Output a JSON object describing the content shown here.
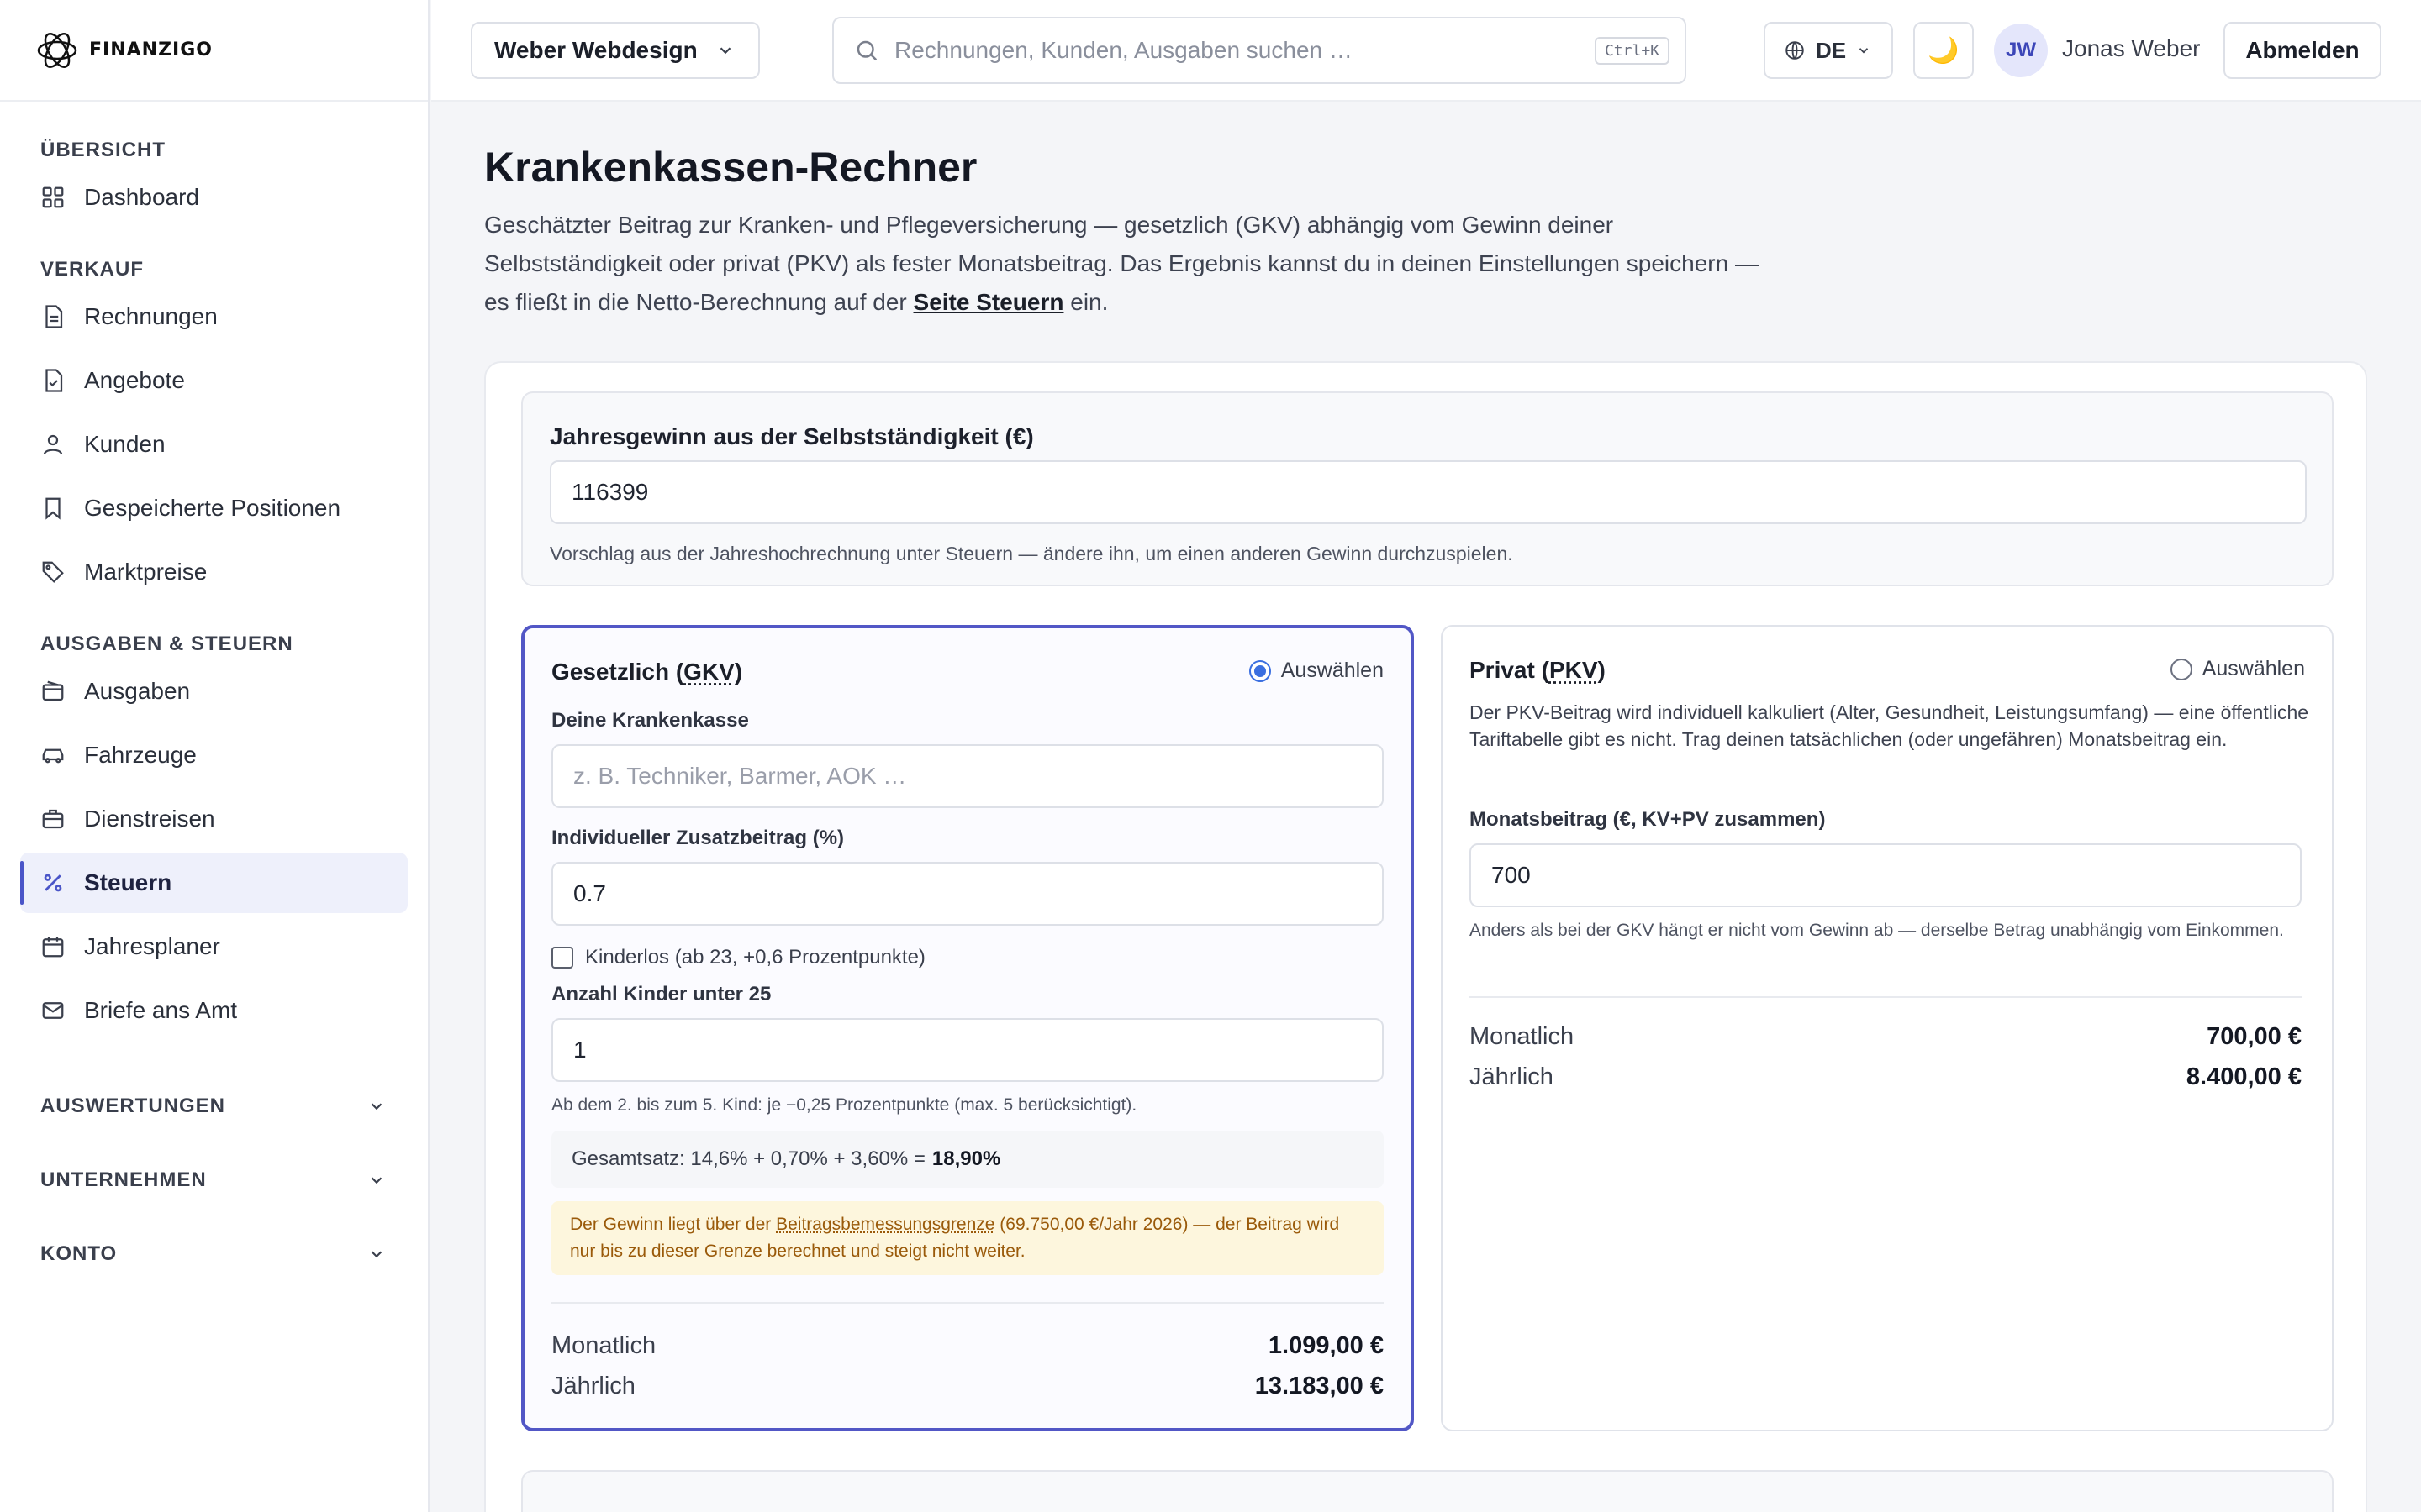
{
  "brand": {
    "name": "FINANZIGO"
  },
  "sidebar": {
    "sections": [
      {
        "title": "ÜBERSICHT",
        "items": [
          {
            "label": "Dashboard",
            "icon": "grid-icon"
          }
        ]
      },
      {
        "title": "VERKAUF",
        "items": [
          {
            "label": "Rechnungen",
            "icon": "document-icon"
          },
          {
            "label": "Angebote",
            "icon": "document-check-icon"
          },
          {
            "label": "Kunden",
            "icon": "user-icon"
          },
          {
            "label": "Gespeicherte Positionen",
            "icon": "bookmark-icon"
          },
          {
            "label": "Marktpreise",
            "icon": "tag-icon"
          }
        ]
      },
      {
        "title": "AUSGABEN & STEUERN",
        "items": [
          {
            "label": "Ausgaben",
            "icon": "wallet-icon"
          },
          {
            "label": "Fahrzeuge",
            "icon": "car-icon"
          },
          {
            "label": "Dienstreisen",
            "icon": "briefcase-icon"
          },
          {
            "label": "Steuern",
            "icon": "percent-icon",
            "active": true
          },
          {
            "label": "Jahresplaner",
            "icon": "calendar-icon"
          },
          {
            "label": "Briefe ans Amt",
            "icon": "mail-icon"
          }
        ]
      }
    ],
    "collapsibles": [
      "AUSWERTUNGEN",
      "UNTERNEHMEN",
      "KONTO"
    ]
  },
  "topbar": {
    "company": "Weber Webdesign",
    "search_placeholder": "Rechnungen, Kunden, Ausgaben suchen …",
    "shortcut": "Ctrl+K",
    "language": "DE",
    "theme_icon": "🌙",
    "avatar_initials": "JW",
    "user_name": "Jonas Weber",
    "logout": "Abmelden"
  },
  "page": {
    "title": "Krankenkassen-Rechner",
    "desc_part1": "Geschätzter Beitrag zur Kranken- und Pflegeversicherung — gesetzlich (GKV) abhängig vom Gewinn deiner Selbstständigkeit oder privat (PKV) als fester Monatsbeitrag. Das Ergebnis kannst du in deinen Einstellungen speichern — es fließt in die Netto-Berechnung auf der ",
    "desc_link": "Seite Steuern",
    "desc_part2": " ein."
  },
  "profit": {
    "label": "Jahresgewinn aus der Selbstständigkeit (€)",
    "value": "116399",
    "hint": "Vorschlag aus der Jahreshochrechnung unter Steuern — ändere ihn, um einen anderen Gewinn durchzuspielen."
  },
  "gkv": {
    "title_prefix": "Gesetzlich (",
    "title_abbr": "GKV",
    "title_suffix": ")",
    "select_label": "Auswählen",
    "selected": true,
    "insurer_label": "Deine Krankenkasse",
    "insurer_placeholder": "z. B. Techniker, Barmer, AOK …",
    "extra_label": "Individueller Zusatzbeitrag (%)",
    "extra_value": "0.7",
    "childless_label": "Kinderlos (ab 23, +0,6 Prozentpunkte)",
    "childless_checked": false,
    "children_label": "Anzahl Kinder unter 25",
    "children_value": "1",
    "children_hint": "Ab dem 2. bis zum 5. Kind: je −0,25 Prozentpunkte (max. 5 berücksichtigt).",
    "rate_text": "Gesamtsatz: 14,6% + 0,70% + 3,60% =",
    "rate_total": "18,90%",
    "warn_part1": "Der Gewinn liegt über der ",
    "warn_term": "Beitragsbemessungsgrenze",
    "warn_part2": " (69.750,00 €/Jahr 2026) — der Beitrag wird nur bis zu dieser Grenze berechnet und steigt nicht weiter.",
    "monthly_label": "Monatlich",
    "monthly_value": "1.099,00 €",
    "yearly_label": "Jährlich",
    "yearly_value": "13.183,00 €"
  },
  "pkv": {
    "title_prefix": "Privat (",
    "title_abbr": "PKV",
    "title_suffix": ")",
    "select_label": "Auswählen",
    "selected": false,
    "desc": "Der PKV-Beitrag wird individuell kalkuliert (Alter, Gesundheit, Leistungsumfang) — eine öffentliche Tariftabelle gibt es nicht. Trag deinen tatsächlichen (oder ungefähren) Monatsbeitrag ein.",
    "amount_label": "Monatsbeitrag (€, KV+PV zusammen)",
    "amount_value": "700",
    "amount_hint": "Anders als bei der GKV hängt er nicht vom Gewinn ab — derselbe Betrag unabhängig vom Einkommen.",
    "monthly_label": "Monatlich",
    "monthly_value": "700,00 €",
    "yearly_label": "Jährlich",
    "yearly_value": "8.400,00 €"
  },
  "colors": {
    "accent": "#5257c6",
    "radio": "#3b6fe0",
    "warn_bg": "#fdf6dd",
    "warn_text": "#9a5a0a"
  }
}
